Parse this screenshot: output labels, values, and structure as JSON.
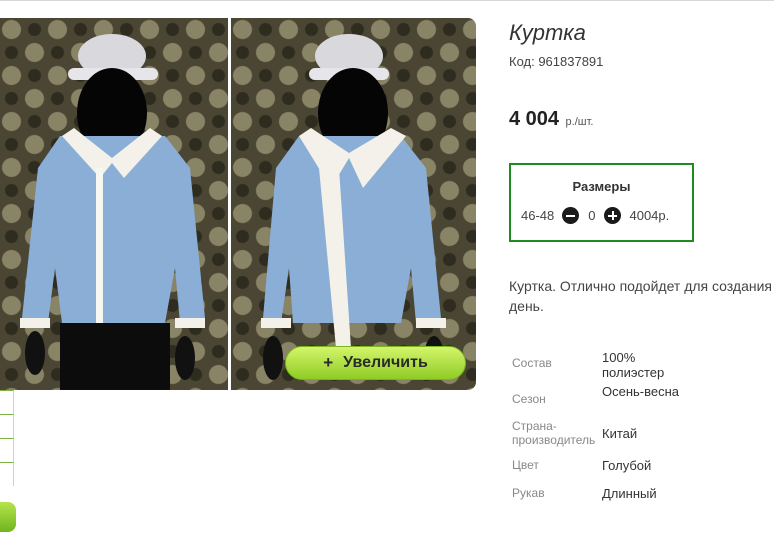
{
  "product": {
    "title": "Куртка",
    "code": "Код: 961837891",
    "price": "4 004",
    "price_unit": "р./шт.",
    "zoom_button": {
      "icon": "plus",
      "label": "Увеличить"
    }
  },
  "sizes": {
    "heading": "Размеры",
    "rows": [
      {
        "size": "46-48",
        "quantity": "0",
        "price": "4004р."
      }
    ]
  },
  "description": "Куртка. Отлично подойдет для создания день.",
  "attributes": [
    {
      "key": "Состав",
      "value": "100% полиэстер"
    },
    {
      "key": "Сезон",
      "value": "Осень-весна"
    },
    {
      "key": "Страна-производитель",
      "value": "Китай"
    },
    {
      "key": "Цвет",
      "value": "Голубой"
    },
    {
      "key": "Рукав",
      "value": "Длинный"
    }
  ],
  "colors": {
    "accent_green": "#8fcc25",
    "sizes_border": "#1e8c1e"
  }
}
